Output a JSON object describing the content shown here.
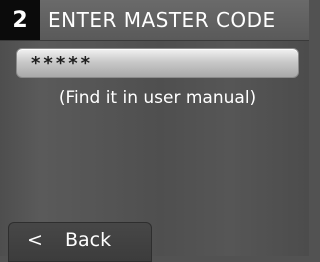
{
  "header": {
    "step_number": "2",
    "title": "ENTER MASTER CODE"
  },
  "code_field": {
    "value": "*****"
  },
  "hint": "(Find it in user manual)",
  "back_button": {
    "chevron": "<",
    "label": "Back"
  },
  "colors": {
    "background": "#525252",
    "header_bg": "#5f5f5f",
    "step_badge_bg": "#0b0b0b",
    "field_bg": "#d0d0d0",
    "text": "#ffffff"
  }
}
